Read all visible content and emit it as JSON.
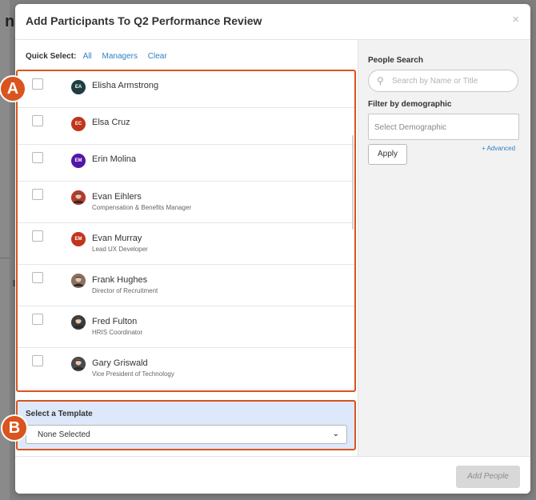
{
  "backdrop": {
    "letter": "n"
  },
  "modal": {
    "title": "Add Participants To Q2 Performance Review",
    "close_glyph": "×"
  },
  "quick_select": {
    "label": "Quick Select:",
    "links": [
      "All",
      "Managers",
      "Clear"
    ]
  },
  "participants": [
    {
      "initials": "EA",
      "name": "Elisha Armstrong",
      "title": "",
      "avatar_color": "#1e3d40",
      "photo": false
    },
    {
      "initials": "EC",
      "name": "Elsa Cruz",
      "title": "",
      "avatar_color": "#c0361c",
      "photo": false
    },
    {
      "initials": "EM",
      "name": "Erin Molina",
      "title": "",
      "avatar_color": "#5416a8",
      "photo": false
    },
    {
      "initials": "",
      "name": "Evan Eihlers",
      "title": "Compensation & Benefits Manager",
      "avatar_color": "#b33a2c",
      "photo": true
    },
    {
      "initials": "EM",
      "name": "Evan Murray",
      "title": "Lead UX Developer",
      "avatar_color": "#c0361c",
      "photo": false
    },
    {
      "initials": "",
      "name": "Frank Hughes",
      "title": "Director of Recruitment",
      "avatar_color": "#8a7060",
      "photo": true
    },
    {
      "initials": "",
      "name": "Fred Fulton",
      "title": "HRIS Coordinator",
      "avatar_color": "#3b3b3b",
      "photo": true
    },
    {
      "initials": "",
      "name": "Gary Griswald",
      "title": "Vice President of Technology",
      "avatar_color": "#4a4a4a",
      "photo": true
    }
  ],
  "template": {
    "label": "Select a Template",
    "selected": "None Selected"
  },
  "search": {
    "label": "People Search",
    "placeholder": "Search by Name or Title"
  },
  "demographic": {
    "label": "Filter by demographic",
    "placeholder": "Select Demographic",
    "advanced_link": "+ Advanced",
    "apply_label": "Apply"
  },
  "footer": {
    "add_label": "Add People"
  },
  "markers": {
    "a": "A",
    "b": "B"
  },
  "colors": {
    "accent": "#d9541e",
    "link": "#2f80c8",
    "template_bg": "#dde8fa"
  }
}
